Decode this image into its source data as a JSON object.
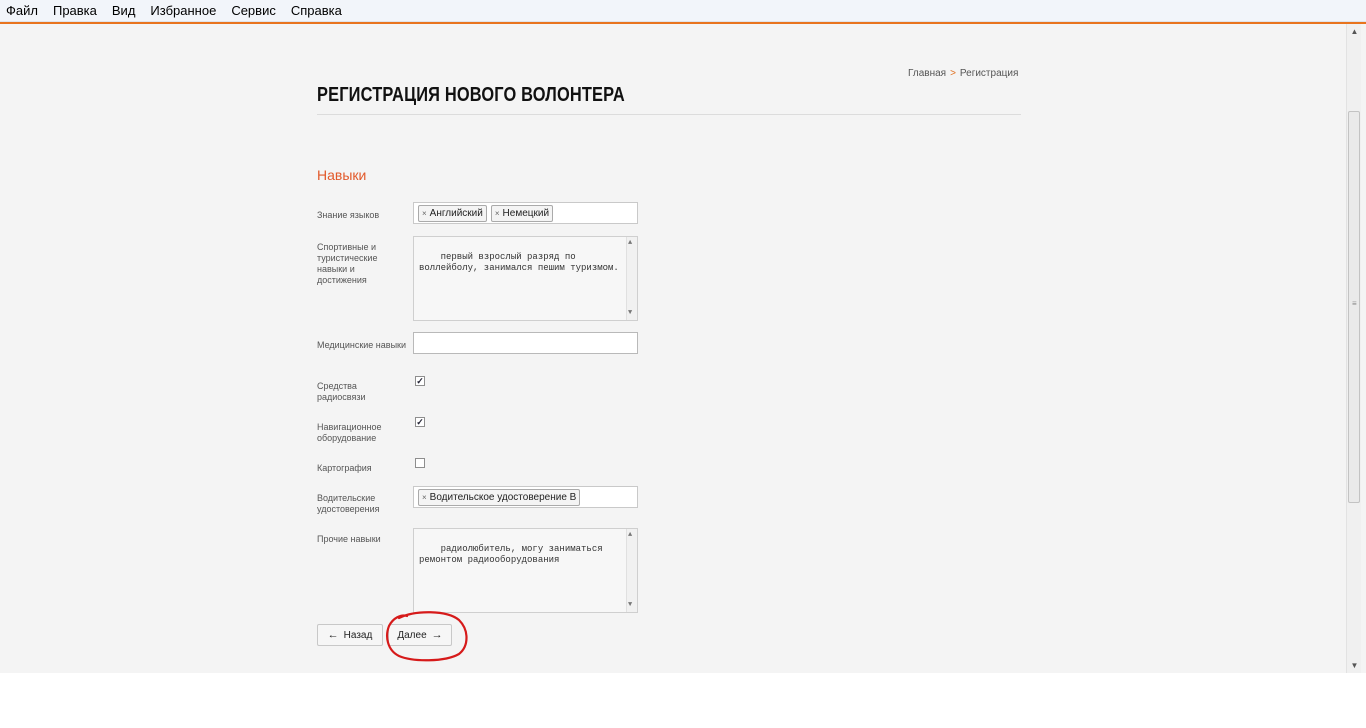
{
  "menu": [
    "Файл",
    "Правка",
    "Вид",
    "Избранное",
    "Сервис",
    "Справка"
  ],
  "page": {
    "title": "РЕГИСТРАЦИЯ НОВОГО ВОЛОНТЕРА",
    "breadcrumb": {
      "home": "Главная",
      "current": "Регистрация"
    }
  },
  "section": {
    "title": "Навыки"
  },
  "fields": {
    "languages": {
      "label": "Знание языков",
      "tags": [
        "Английский",
        "Немецкий"
      ]
    },
    "sports": {
      "label": "Спортивные и туристические навыки и достижения",
      "value": "первый взрослый разряд по воллейболу, занимался пешим туризмом."
    },
    "medical": {
      "label": "Медицинские навыки",
      "value": ""
    },
    "radio": {
      "label": "Средства радиосвязи",
      "checked": true
    },
    "navigation": {
      "label": "Навигационное оборудование",
      "checked": true
    },
    "cartography": {
      "label": "Картография",
      "checked": false
    },
    "drivers": {
      "label": "Водительские удостоверения",
      "tags": [
        "Водительское удостоверение B"
      ]
    },
    "other": {
      "label": "Прочие навыки",
      "value": "радиолюбитель, могу заниматься ремонтом радиооборудования"
    }
  },
  "buttons": {
    "back": "Назад",
    "next": "Далее"
  },
  "icons": {
    "tag_remove": "×",
    "check": "✓",
    "arrow_left": "←",
    "arrow_right": "→"
  },
  "colors": {
    "accent": "#e2592a",
    "annotation": "#d61a1a"
  }
}
